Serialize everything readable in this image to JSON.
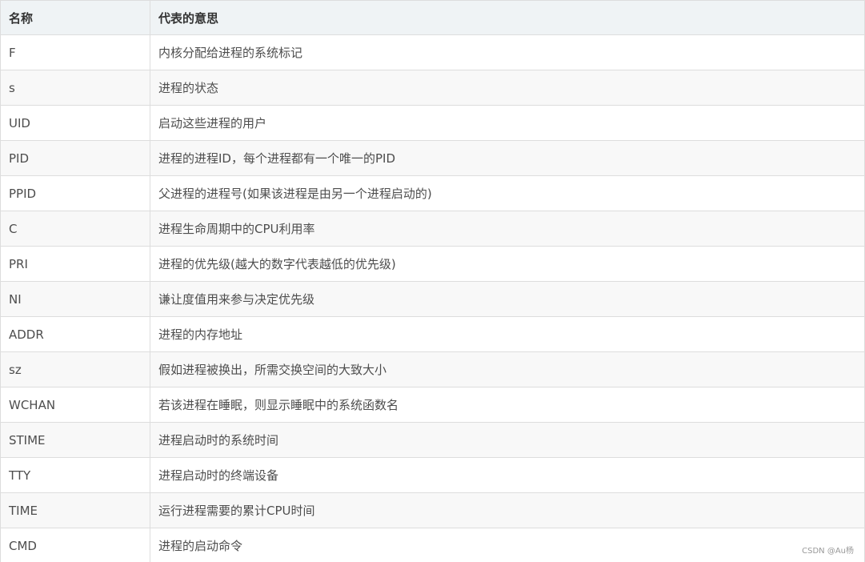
{
  "table": {
    "headers": {
      "name": "名称",
      "meaning": "代表的意思"
    },
    "rows": [
      {
        "name": "F",
        "meaning": "内核分配给进程的系统标记"
      },
      {
        "name": "s",
        "meaning": "进程的状态"
      },
      {
        "name": "UID",
        "meaning": "启动这些进程的用户"
      },
      {
        "name": "PID",
        "meaning": "进程的进程ID，每个进程都有一个唯一的PID"
      },
      {
        "name": "PPID",
        "meaning": "父进程的进程号(如果该进程是由另一个进程启动的)"
      },
      {
        "name": "C",
        "meaning": "进程生命周期中的CPU利用率"
      },
      {
        "name": "PRI",
        "meaning": "进程的优先级(越大的数字代表越低的优先级)"
      },
      {
        "name": "NI",
        "meaning": "谦让度值用来参与决定优先级"
      },
      {
        "name": "ADDR",
        "meaning": "进程的内存地址"
      },
      {
        "name": "sz",
        "meaning": "假如进程被换出，所需交换空间的大致大小"
      },
      {
        "name": "WCHAN",
        "meaning": "若该进程在睡眠，则显示睡眠中的系统函数名"
      },
      {
        "name": "STIME",
        "meaning": "进程启动时的系统时间"
      },
      {
        "name": "TTY",
        "meaning": "进程启动时的终端设备"
      },
      {
        "name": "TIME",
        "meaning": "运行进程需要的累计CPU时间"
      },
      {
        "name": "CMD",
        "meaning": "进程的启动命令"
      }
    ]
  },
  "watermark": "CSDN @Au杨"
}
